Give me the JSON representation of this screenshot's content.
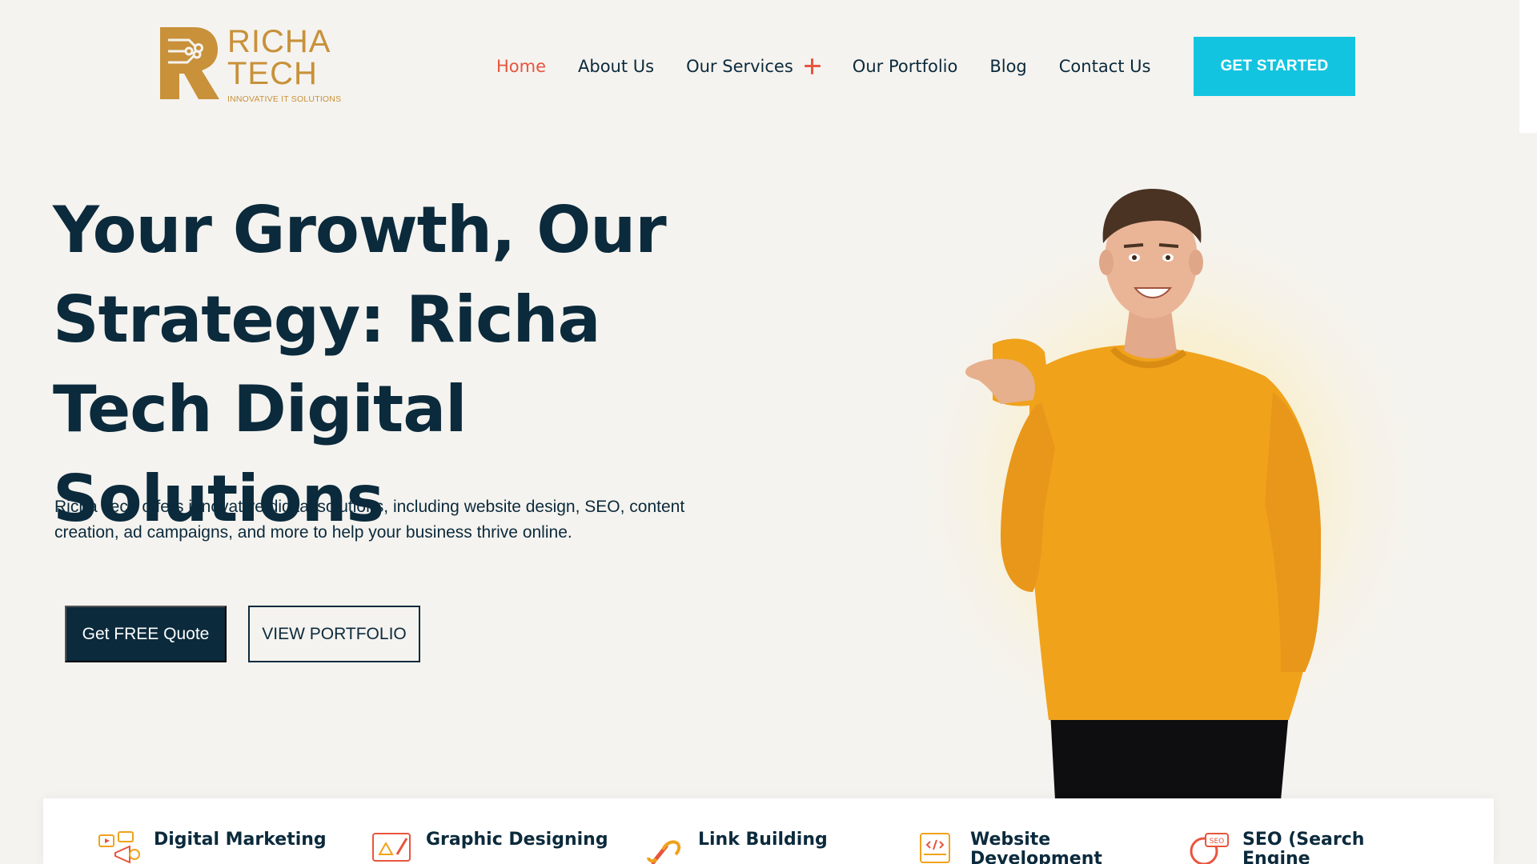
{
  "brand": {
    "line1": "RICHA",
    "line2": "TECH",
    "tagline": "INNOVATIVE IT SOLUTIONS",
    "color": "#c8913a"
  },
  "nav": {
    "items": [
      {
        "label": "Home",
        "active": true
      },
      {
        "label": "About Us"
      },
      {
        "label": "Our Services",
        "icon": "plus-icon"
      },
      {
        "label": "Our Portfolio"
      },
      {
        "label": "Blog"
      },
      {
        "label": "Contact Us"
      }
    ],
    "cta": "GET STARTED",
    "active_color": "#e8553e",
    "cta_color": "#13c4e0"
  },
  "hero": {
    "title": "Your Growth, Our Strategy: Richa Tech Digital Solutions",
    "description": "Richa Tech offers innovative digital solutions, including website design, SEO, content creation, ad campaigns, and more to help your business thrive online.",
    "primary_button": "Get FREE Quote",
    "secondary_button": "VIEW PORTFOLIO",
    "text_color": "#0b2a3c",
    "person_image": "man-in-orange-sweater-pointing"
  },
  "services": [
    {
      "label": "Digital Marketing",
      "icon": "digital-marketing-icon"
    },
    {
      "label": "Graphic Designing",
      "icon": "graphic-design-icon"
    },
    {
      "label": "Link Building",
      "icon": "link-icon"
    },
    {
      "label": "Website Development",
      "icon": "web-development-icon"
    },
    {
      "label": "SEO (Search Engine Optimization)",
      "icon": "seo-icon"
    }
  ]
}
